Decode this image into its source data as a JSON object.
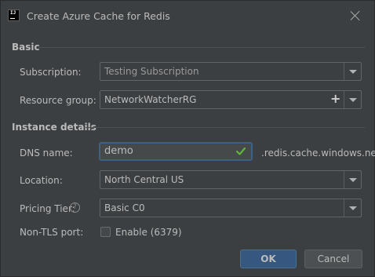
{
  "window": {
    "title": "Create Azure Cache for Redis",
    "app_icon": "intellij-icon",
    "app_icon_text": "IJ"
  },
  "basic": {
    "section_title": "Basic",
    "subscription": {
      "label": "Subscription:",
      "value": "Testing Subscription"
    },
    "resource_group": {
      "label": "Resource group:",
      "value": "NetworkWatcherRG"
    }
  },
  "instance": {
    "section_title": "Instance details",
    "dns_name": {
      "label": "DNS name:",
      "value": "demo",
      "suffix": ".redis.cache.windows.net",
      "valid": true
    },
    "location": {
      "label": "Location:",
      "value": "North Central US"
    },
    "pricing_tier": {
      "label": "Pricing Tier:",
      "help": "?",
      "value": "Basic C0"
    },
    "non_tls_port": {
      "label": "Non-TLS port:",
      "checkbox_label": "Enable (6379)",
      "checked": false
    }
  },
  "buttons": {
    "ok": "OK",
    "cancel": "Cancel"
  },
  "colors": {
    "accent": "#365880",
    "valid_check": "#5fb83a",
    "background": "#3c3f41"
  }
}
